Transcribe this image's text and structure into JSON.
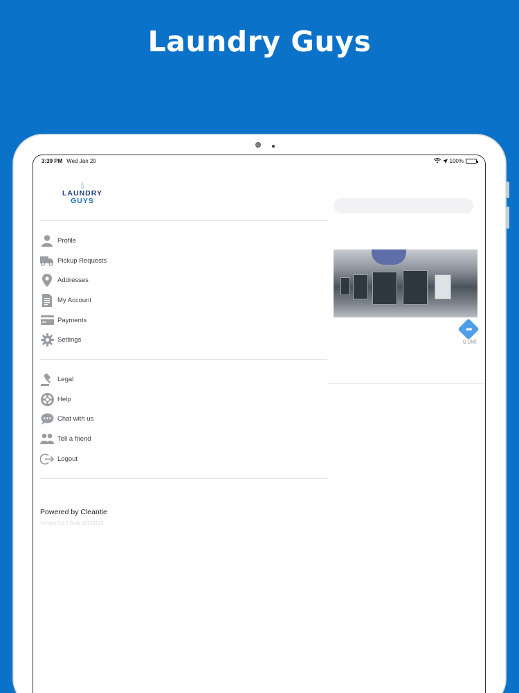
{
  "promo": {
    "title": "Laundry Guys"
  },
  "status_bar": {
    "time": "3:39 PM",
    "date": "Wed Jan 20",
    "battery": "100%"
  },
  "logo": {
    "line1": "LAUNDRY",
    "line2": "GUYS"
  },
  "menu_primary": [
    {
      "label": "Profile",
      "icon": "person-icon"
    },
    {
      "label": "Pickup Requests",
      "icon": "truck-icon"
    },
    {
      "label": "Addresses",
      "icon": "map-pin-icon"
    },
    {
      "label": "My Account",
      "icon": "document-icon"
    },
    {
      "label": "Payments",
      "icon": "credit-card-icon"
    },
    {
      "label": "Settings",
      "icon": "gear-icon"
    }
  ],
  "menu_secondary": [
    {
      "label": "Legal",
      "icon": "gavel-icon"
    },
    {
      "label": "Help",
      "icon": "lifebuoy-icon"
    },
    {
      "label": "Chat with us",
      "icon": "chat-bubble-icon"
    },
    {
      "label": "Tell a friend",
      "icon": "people-icon"
    },
    {
      "label": "Logout",
      "icon": "logout-icon"
    }
  ],
  "footer": {
    "powered_by": "Powered by Cleantie",
    "version": "Version 3.2.3 Build 20210120"
  },
  "background": {
    "distance": "0.0MI"
  },
  "colors": {
    "brand_blue": "#0b72c9",
    "icon_gray": "#9a9ea3"
  }
}
